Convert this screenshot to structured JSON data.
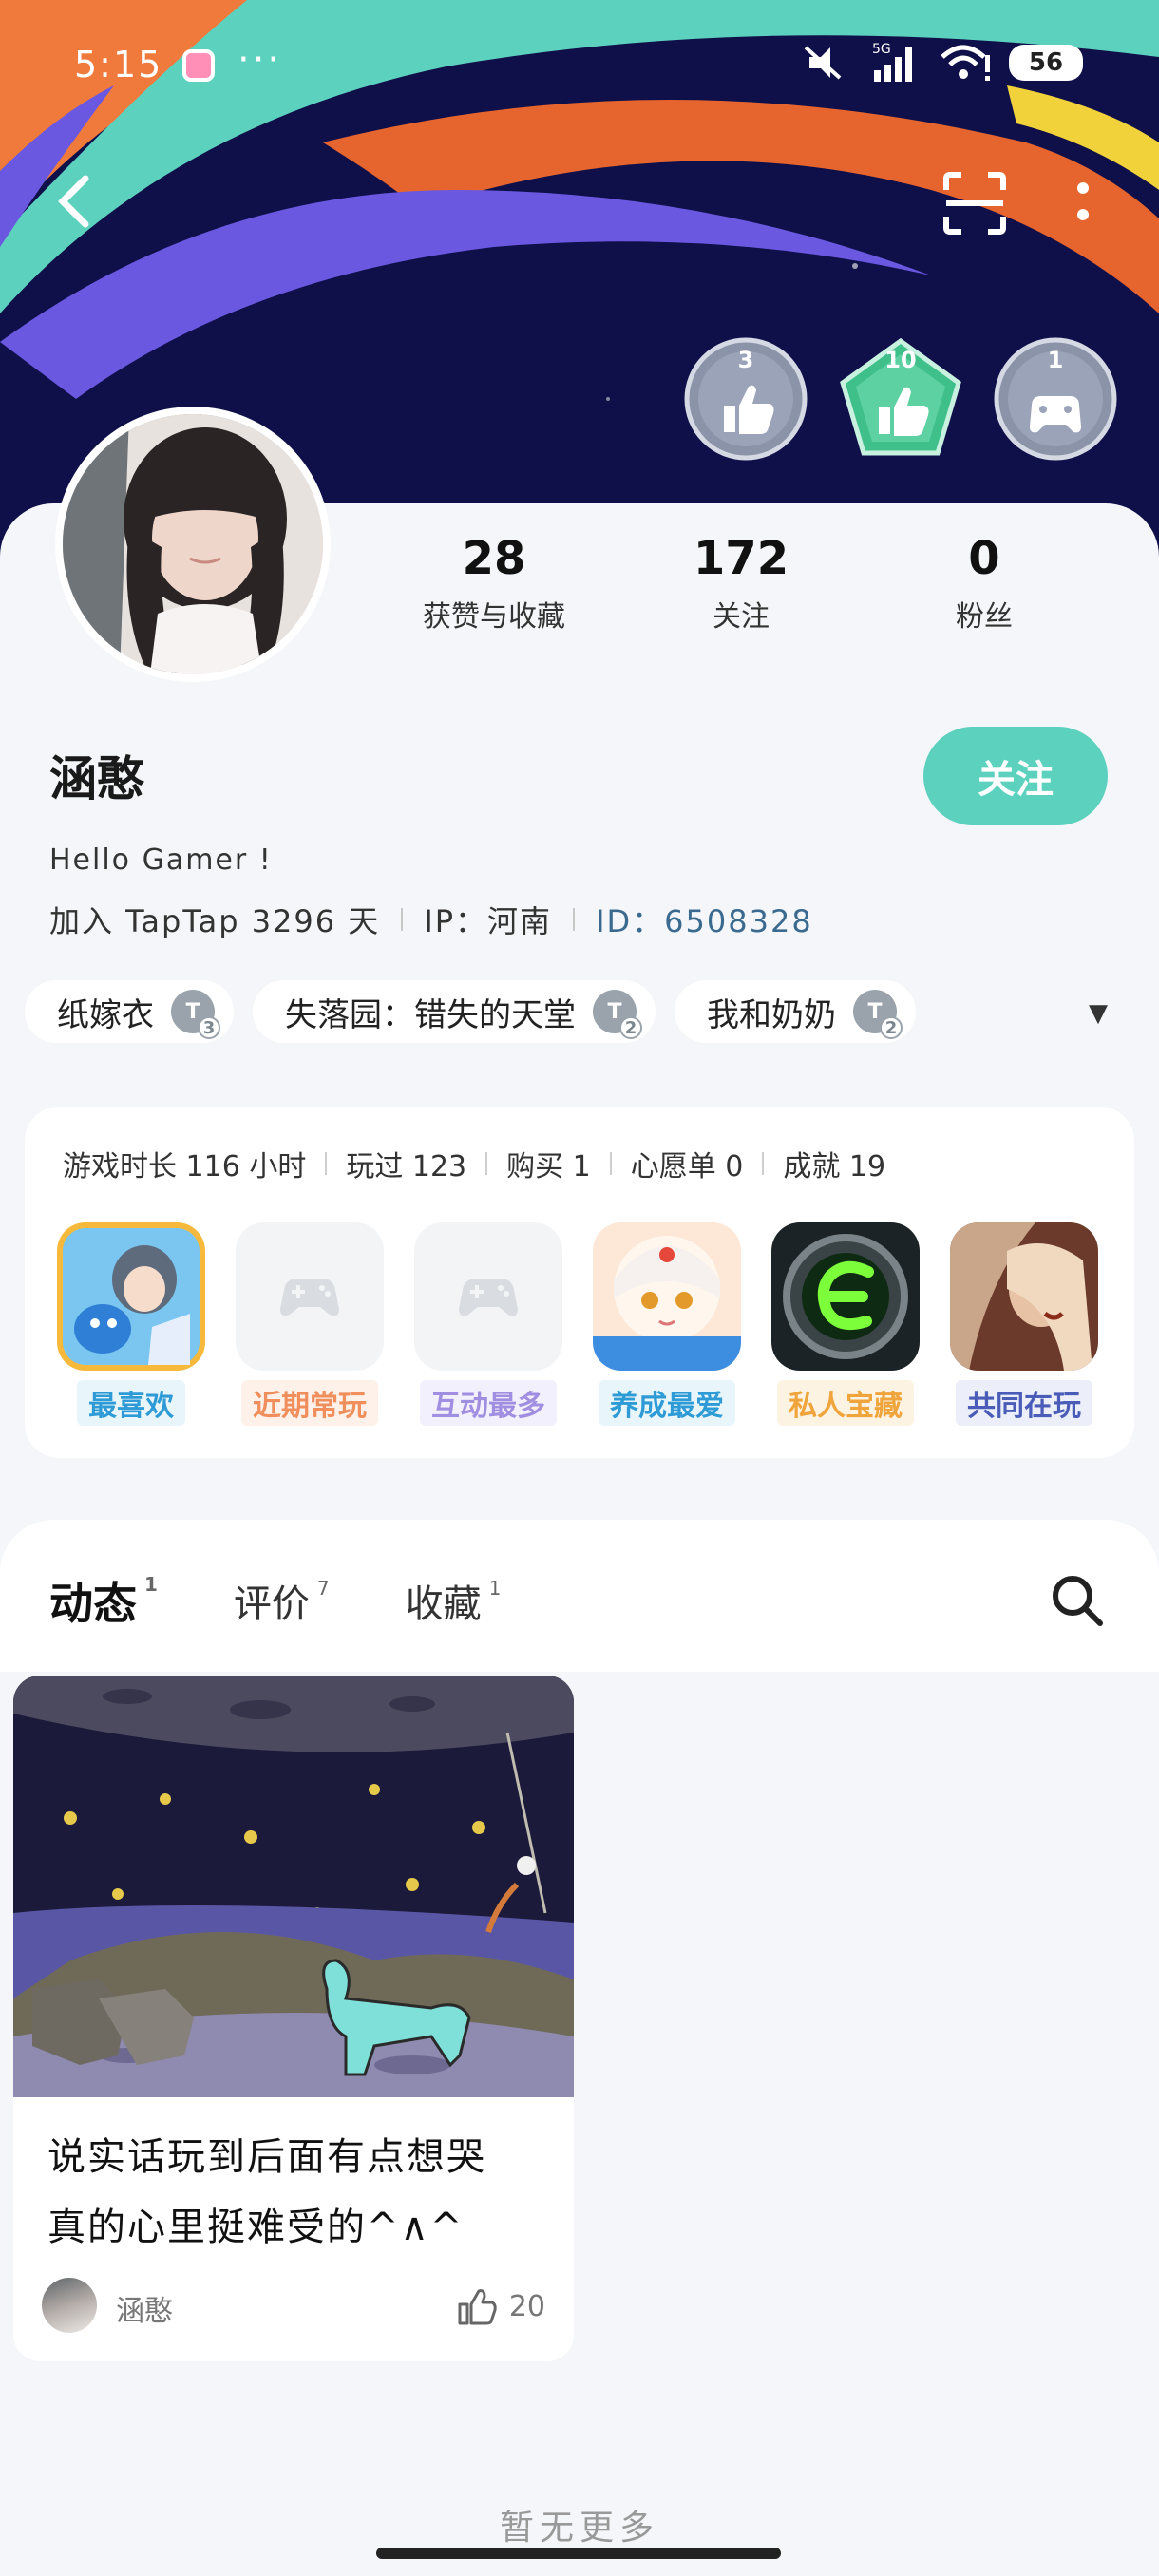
{
  "status_bar": {
    "time": "5:15",
    "dots": "···",
    "network": "5G",
    "battery": "56"
  },
  "profile": {
    "stats": [
      {
        "value": "28",
        "label": "获赞与收藏"
      },
      {
        "value": "172",
        "label": "关注"
      },
      {
        "value": "0",
        "label": "粉丝"
      }
    ],
    "badges": [
      {
        "num": "3",
        "icon": "thumbs-up-badge-icon"
      },
      {
        "num": "10",
        "icon": "thumbs-up-badge-icon"
      },
      {
        "num": "1",
        "icon": "gamepad-badge-icon"
      }
    ],
    "name": "涵憨",
    "follow_label": "关注",
    "bio": "Hello Gamer !",
    "joined": "加入 TapTap 3296 天",
    "ip": "IP：河南",
    "id_label": "ID：",
    "id_value": "6508328"
  },
  "tags": [
    {
      "name": "纸嫁衣",
      "level": "3"
    },
    {
      "name": "失落园：错失的天堂",
      "level": "2"
    },
    {
      "name": "我和奶奶",
      "level": "2"
    }
  ],
  "game_stats": [
    "游戏时长 116 小时",
    "玩过 123",
    "购买 1",
    "心愿单 0",
    "成就 19"
  ],
  "games": [
    {
      "label": "最喜欢",
      "color": "#2f9bd6",
      "bg": "#e8f6fb"
    },
    {
      "label": "近期常玩",
      "color": "#f08e5c",
      "bg": "#fdf1ea"
    },
    {
      "label": "互动最多",
      "color": "#a08ee0",
      "bg": "#f3f0fd"
    },
    {
      "label": "养成最爱",
      "color": "#2f9bd6",
      "bg": "#e8f6fb"
    },
    {
      "label": "私人宝藏",
      "color": "#f0a53c",
      "bg": "#fdf3e3"
    },
    {
      "label": "共同在玩",
      "color": "#4a5cb8",
      "bg": "#eceffa"
    }
  ],
  "tabs": [
    {
      "label": "动态",
      "count": "1"
    },
    {
      "label": "评价",
      "count": "7"
    },
    {
      "label": "收藏",
      "count": "1"
    }
  ],
  "post": {
    "text_line1": "说实话玩到后面有点想哭",
    "text_line2": "真的心里挺难受的^∧^",
    "user": "涵憨",
    "likes": "20"
  },
  "footer": {
    "no_more": "暂无更多"
  },
  "colors": {
    "accent": "#5cd1bd",
    "banner_bg": "#0f0f4a"
  }
}
